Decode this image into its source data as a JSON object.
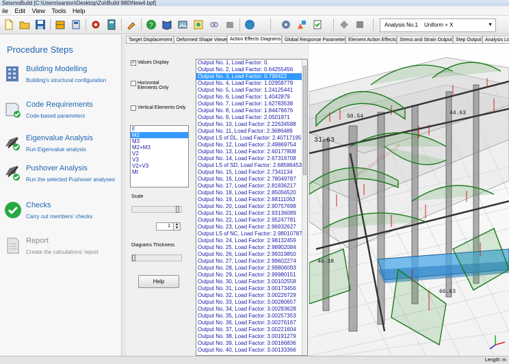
{
  "window": {
    "title": "SeismoBuild  [C:\\Users\\santon\\Desktop\\Zoi\\Build 980\\New4.bpf]"
  },
  "menu": [
    "ile",
    "Edit",
    "View",
    "Tools",
    "Help"
  ],
  "toolbar": {
    "analysis_label": "Analysis No.1",
    "load_pattern": "Uniform  + X",
    "icons": [
      "new-icon",
      "open-icon",
      "save-icon",
      "building-icon",
      "sections-icon",
      "settings-icon",
      "calculator-icon",
      "paint-icon",
      "help-icon",
      "book-icon",
      "image-icon",
      "web-icon",
      "link-icon",
      "gray-icon",
      "globe-icon",
      "gear-icon",
      "shapes-icon",
      "checklist-icon",
      "diamond-icon",
      "square-icon"
    ]
  },
  "procedure": {
    "title": "Procedure Steps",
    "steps": [
      {
        "title": "Building Modelling",
        "desc": "Building's structural configuration",
        "icon": "building-icon"
      },
      {
        "title": "Code Requirements",
        "desc": "Code-based parameters",
        "icon": "code-requirements-icon"
      },
      {
        "title": "Eigenvalue Analysis",
        "desc": "Run Eigenvalue analysis",
        "icon": "eigenvalue-icon"
      },
      {
        "title": "Pushover Analysis",
        "desc": "Run the selected Pushover analyses",
        "icon": "pushover-icon"
      },
      {
        "title": "Checks",
        "desc": "Carry out members' checks",
        "icon": "check-icon"
      },
      {
        "title": "Report",
        "desc": "Create the calculations' report",
        "icon": "report-icon"
      }
    ]
  },
  "tabs": [
    "Target Displacement",
    "Deformed Shape Viewer",
    "Action Effects Diagrams",
    "Global Response Parameters",
    "Element Action Effects",
    "Stress and Strain Output",
    "Step Output",
    "Analysis Lo"
  ],
  "options": {
    "values_display": "Values Display",
    "horizontal_elements": "Horizontal Elements Only",
    "vertical_elements": "Vertical Elements Only",
    "effects": [
      "F",
      "M2",
      "M3",
      "M2+M3",
      "V2",
      "V3",
      "V2+V3",
      "Mt"
    ],
    "selected_effect": "M2",
    "scale_label": "Scale",
    "scale_value": "1",
    "diagrams_thickness_label": "Diagrams Thickness",
    "help": "Help"
  },
  "outputs": [
    "Output No.   1,   Load Factor: 0.",
    "Output No.   2,   Load Factor: 0.64255456",
    "Output No.   3,   Load Factor: 0.796422",
    "Output No.   4,   Load Factor: 1.02958779",
    "Output No.   5,   Load Factor: 1.24125441",
    "Output No.   6,   Load Factor: 1.4042879",
    "Output No.   7,   Load Factor: 1.62783538",
    "Output No.   8,   Load Factor: 1.84476676",
    "Output No.   9,   Load Factor: 2.0501971",
    "Output No.   10,   Load Factor: 2.22634588",
    "Output No.   11,   Load Factor: 2.3686489",
    "Output LS of DL, Load Factor: 2.40717195",
    "Output No.   12,   Load Factor: 2.49869754",
    "Output No.   13,   Load Factor: 2.60177808",
    "Output No.   14,   Load Factor: 2.67316708",
    "Output LS of SD, Load Factor: 2.68586453",
    "Output No.   15,   Load Factor: 2.7341134",
    "Output No.   16,   Load Factor: 2.78049787",
    "Output No.   17,   Load Factor: 2.81836217",
    "Output No.   18,   Load Factor: 2.85056520",
    "Output No.   19,   Load Factor: 2.88111063",
    "Output No.   20,   Load Factor: 2.90757698",
    "Output No.   21,   Load Factor: 2.93136089",
    "Output No.   22,   Load Factor: 2.95247781",
    "Output No.   23,   Load Factor: 2.96932627",
    "Output LS of NC, Load Factor: 2.98010787",
    "Output No.   24,   Load Factor: 2.98132459",
    "Output No.   25,   Load Factor: 2.98902084",
    "Output No.   26,   Load Factor: 2.99319850",
    "Output No.   27,   Load Factor: 2.99602274",
    "Output No.   28,   Load Factor: 2.99806093",
    "Output No.   29,   Load Factor: 2.99980151",
    "Output No.   30,   Load Factor: 3.00102558",
    "Output No.   31,   Load Factor: 3.00173456",
    "Output No.   32,   Load Factor: 3.00226729",
    "Output No.   33,   Load Factor: 3.00280657",
    "Output No.   34,   Load Factor: 3.00293628",
    "Output No.   35,   Load Factor: 3.00257353",
    "Output No.   36,   Load Factor: 3.00276167",
    "Output No.   37,   Load Factor: 3.00221604",
    "Output No.   38,   Load Factor: 3.00191279",
    "Output No.   39,   Load Factor: 3.00166836",
    "Output No.   40,   Load Factor: 3.00133366"
  ],
  "selected_output_index": 2,
  "viewport": {
    "labels": [
      "31.63",
      "50.54",
      "46.38",
      "66.63",
      "44.63"
    ],
    "watermark": "www.parandco.com"
  },
  "status": {
    "length": "Length: m"
  },
  "colors": {
    "accent": "#3399ff",
    "procedure_text": "#1f67b4",
    "diagram_green": "#1b7a1b",
    "diagram_red": "#cc1111"
  }
}
